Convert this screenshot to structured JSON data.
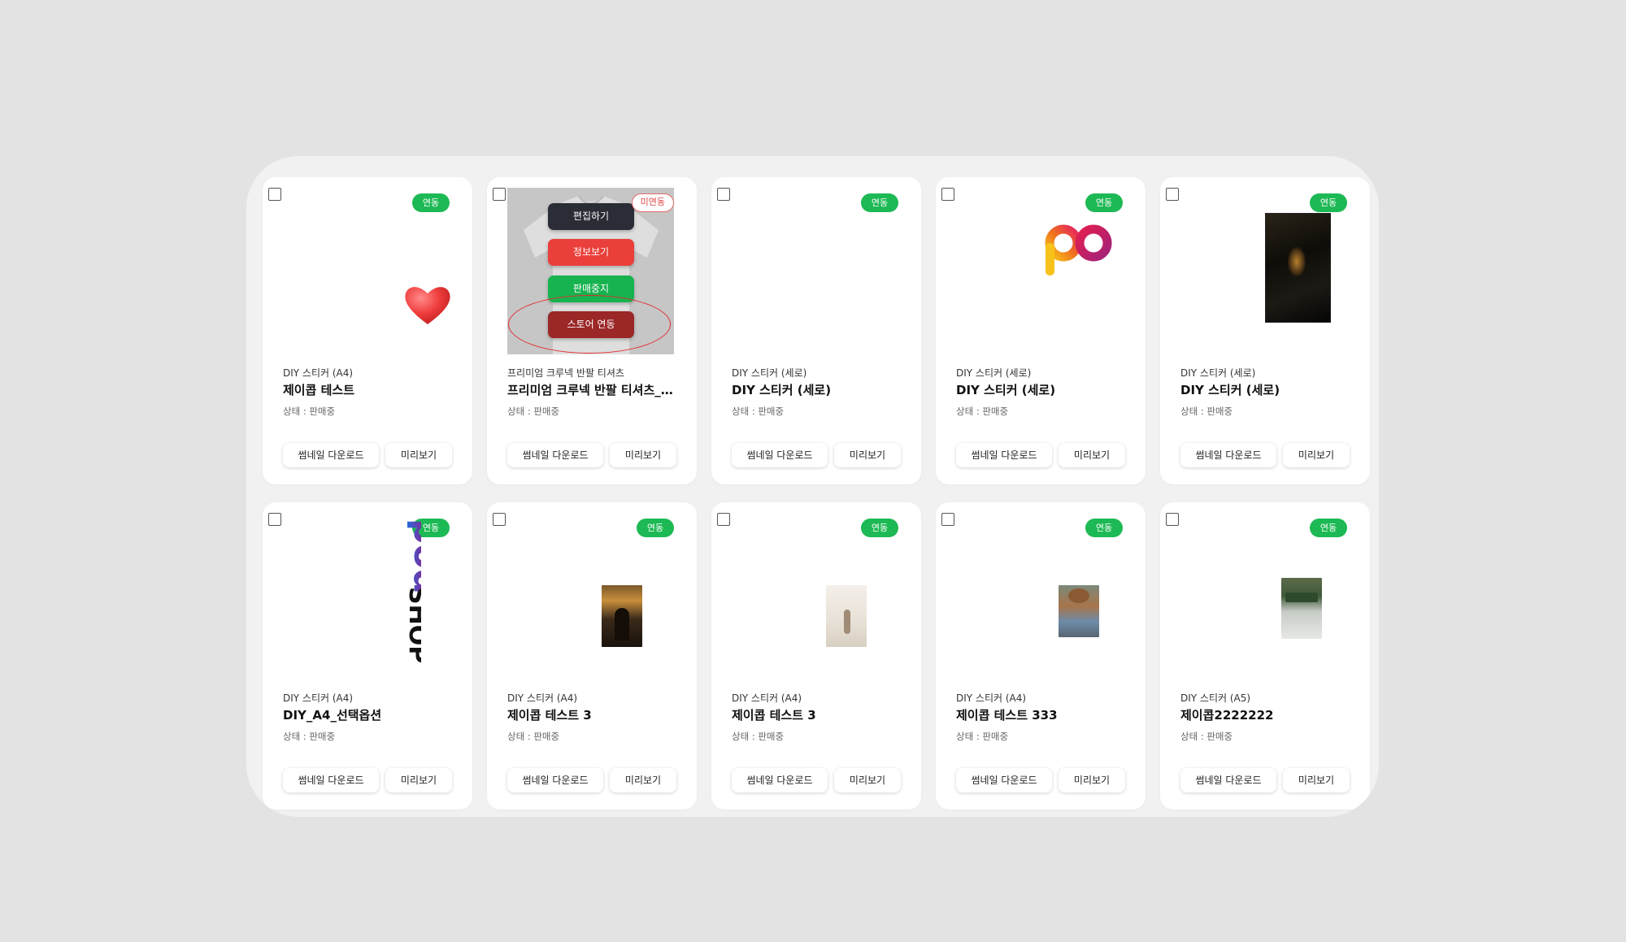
{
  "colors": {
    "badge_linked": "#1db954",
    "badge_unlinked": "#e14646",
    "menu_edit": "#2a2d36",
    "menu_info": "#ea3f3a",
    "menu_stop": "#17b34e",
    "menu_store": "#9b2727"
  },
  "cards": [
    {
      "badge": "연동",
      "type": "DIY 스티커 (A4)",
      "title": "제이콥 테스트",
      "status": "상태 : 판매중",
      "art": "heart-icon"
    },
    {
      "badge": "미연동",
      "type": "프리미엄 크루넥 반팔 티셔츠",
      "title": "프리미엄 크루넥 반팔 티셔츠_…",
      "status": "상태 : 판매중",
      "art": "tshirt-image"
    },
    {
      "badge": "연동",
      "type": "DIY 스티커 (세로)",
      "title": "DIY 스티커 (세로)",
      "status": "상태 : 판매중",
      "art": "blank"
    },
    {
      "badge": "연동",
      "type": "DIY 스티커 (세로)",
      "title": "DIY 스티커 (세로)",
      "status": "상태 : 판매중",
      "art": "po-logo"
    },
    {
      "badge": "연동",
      "type": "DIY 스티커 (세로)",
      "title": "DIY 스티커 (세로)",
      "status": "상태 : 판매중",
      "art": "dark-photo"
    },
    {
      "badge": "연동",
      "type": "DIY 스티커 (A4)",
      "title": "DIY_A4_선택옵션",
      "status": "상태 : 판매중",
      "art": "pod-shop-logo"
    },
    {
      "badge": "연동",
      "type": "DIY 스티커 (A4)",
      "title": "제이콥 테스트 3",
      "status": "상태 : 판매중",
      "art": "night-photo"
    },
    {
      "badge": "연동",
      "type": "DIY 스티커 (A4)",
      "title": "제이콥 테스트 3",
      "status": "상태 : 판매중",
      "art": "beach-photo"
    },
    {
      "badge": "연동",
      "type": "DIY 스티커 (A4)",
      "title": "제이콥 테스트 333",
      "status": "상태 : 판매중",
      "art": "hat-photo"
    },
    {
      "badge": "연동",
      "type": "DIY 스티커 (A5)",
      "title": "제이콥2222222",
      "status": "상태 : 판매중",
      "art": "garden-photo"
    }
  ],
  "buttons": {
    "thumbnail_download": "썸네일 다운로드",
    "preview": "미리보기"
  },
  "overlay_menu": {
    "edit": "편집하기",
    "info": "정보보기",
    "stop_sale": "판매중지",
    "store_link": "스토어 연동"
  },
  "logo_text": {
    "pod": "pod",
    "shop": "SHOP",
    "po": "po"
  }
}
